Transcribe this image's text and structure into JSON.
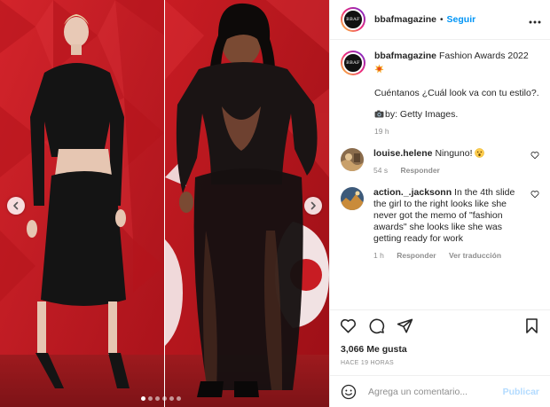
{
  "post": {
    "account": "bbafmagazine",
    "avatar_text": "BBAF",
    "separator": "•",
    "follow_label": "Seguir",
    "more_icon": "more-horizontal-icon",
    "media": {
      "image_count": 6,
      "active_index": 0,
      "left_arrow_icon": "chevron-left-icon",
      "right_arrow_icon": "chevron-right-icon",
      "dot_index": [
        0,
        1,
        2,
        3,
        4,
        5
      ]
    },
    "caption": {
      "username": "bbafmagazine",
      "title": "Fashion Awards 2022",
      "emoji": "fire-emoji-icon",
      "text": "Cuéntanos ¿Cuál look va con tu estilo?.",
      "credit": "by: Getty Images.",
      "credit_icon": "camera-emoji-icon",
      "time": "19 h"
    },
    "comments": [
      {
        "username": "louise.helene",
        "text": "Ninguno!",
        "emoji": "astonished-emoji-icon",
        "time": "54 s",
        "reply": "Responder"
      },
      {
        "username": "action._.jacksonn",
        "text": "In the 4th slide the girl to the right looks like she never got the memo of \"fashion awards\" she looks like she was getting ready for work",
        "time": "1 h",
        "reply": "Responder",
        "translate": "Ver traducción"
      }
    ],
    "actions": [
      "heart-icon",
      "comment-icon",
      "share-icon",
      "bookmark-icon"
    ],
    "likes": "3,066 Me gusta",
    "posted": "HACE 19 HORAS",
    "comment_placeholder": "Agrega un comentario...",
    "publish_label": "Publicar",
    "colors": {
      "link_blue": "#0095f6",
      "publish_disabled": "#b3dbff",
      "secondary_text": "#8e8e8e",
      "backdrop_red": "#c41a22"
    }
  }
}
